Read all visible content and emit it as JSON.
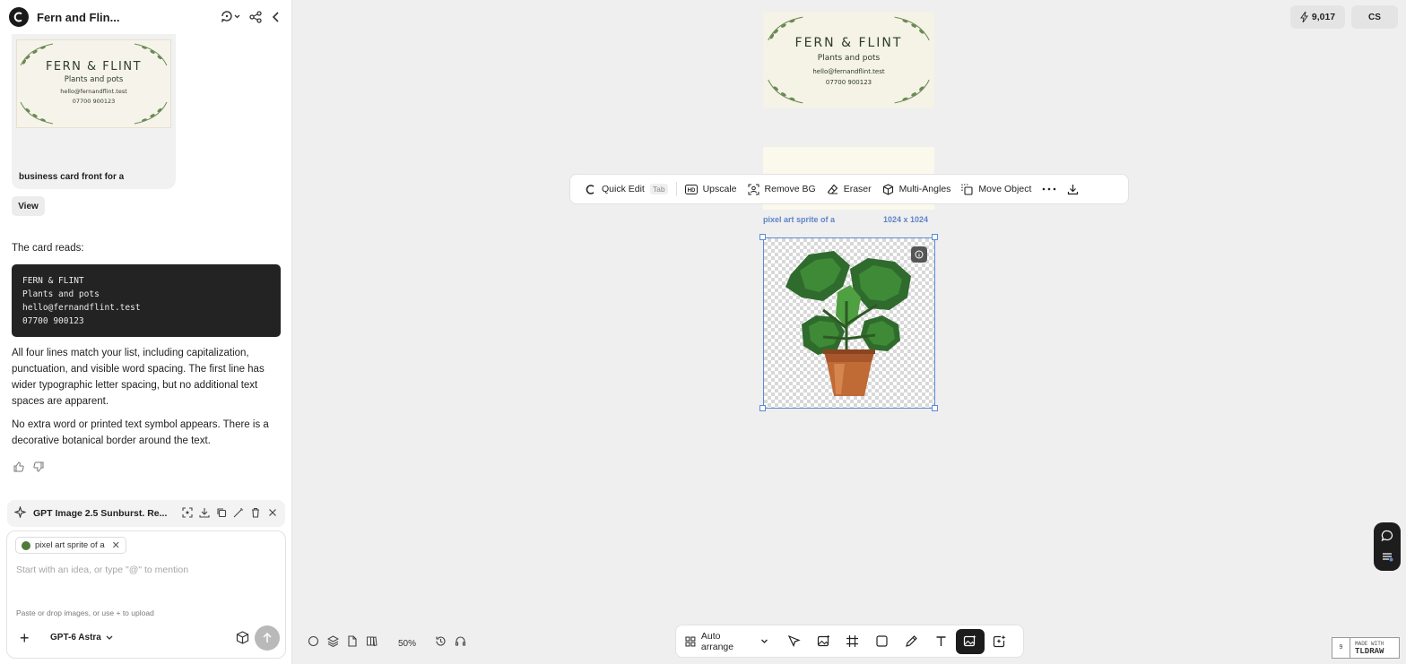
{
  "sidebar": {
    "title": "Fern and Flin...",
    "image_card": {
      "card_name": "FERN & FLINT",
      "card_tagline": "Plants and pots",
      "card_email": "hello@fernandflint.test",
      "card_phone": "07700 900123",
      "caption": "business card front for a"
    },
    "view_label": "View",
    "intro_text": "The card reads:",
    "code_block": "FERN & FLINT\nPlants and pots\nhello@fernandflint.test\n07700 900123",
    "paragraph1": "All four lines match your list, including capitalization, punctuation, and visible word spacing. The first line has wider typographic letter spacing, but no additional text spaces are apparent.",
    "paragraph2": "No extra word or printed text symbol appears. There is a decorative botanical border around the text.",
    "generation_bar": {
      "title": "GPT Image 2.5 Sunburst. Re..."
    },
    "composer": {
      "chip_label": "pixel art sprite of a",
      "placeholder": "Start with an idea, or type \"@\" to mention",
      "hint": "Paste or drop images, or use + to upload",
      "model_label": "GPT-6 Astra"
    }
  },
  "topbar": {
    "credits": "9,017",
    "avatar_initials": "CS"
  },
  "canvas": {
    "business_card": {
      "name": "FERN & FLINT",
      "tagline": "Plants and pots",
      "email": "hello@fernandflint.test",
      "phone": "07700 900123"
    },
    "selected_label": "pixel art sprite of a",
    "selected_size": "1024 x 1024",
    "zoom": "50%"
  },
  "toolbar": {
    "quick_edit": "Quick Edit",
    "tab_hint": "Tab",
    "upscale": "Upscale",
    "remove_bg": "Remove BG",
    "eraser": "Eraser",
    "multi_angles": "Multi-Angles",
    "move_object": "Move Object"
  },
  "bottom_bar": {
    "auto_arrange": "Auto arrange"
  },
  "watermark": {
    "made_with": "MADE WITH",
    "brand": "TLDRAW",
    "badge": "9"
  },
  "colors": {
    "accent_selection": "#5b8bd6",
    "code_bg": "#232323"
  }
}
